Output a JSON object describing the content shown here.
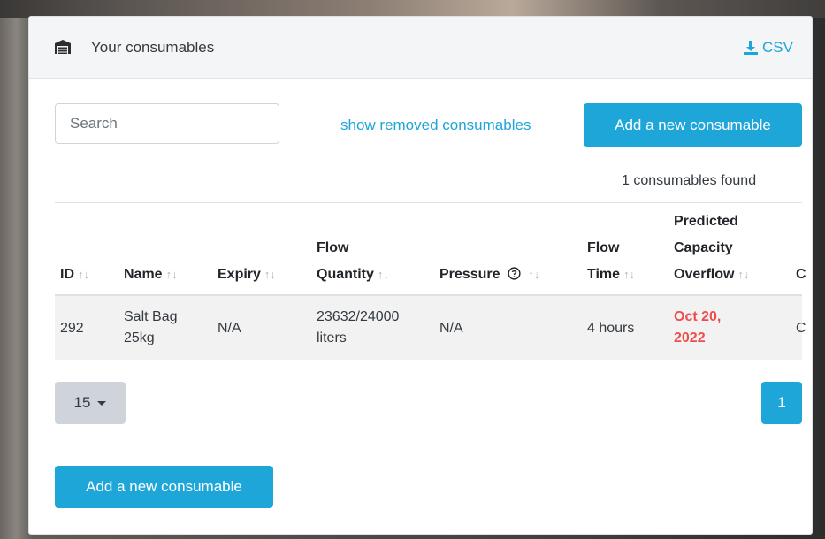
{
  "header": {
    "title": "Your consumables",
    "icon": "warehouse-icon",
    "csv_label": "CSV",
    "csv_icon": "download-icon"
  },
  "toolbar": {
    "search_placeholder": "Search",
    "show_removed_label": "show removed consumables",
    "add_label": "Add a new consumable"
  },
  "results": {
    "count_text": "1 consumables found"
  },
  "table": {
    "sort_glyph": "↑↓",
    "columns": {
      "id": "ID",
      "name": "Name",
      "expiry": "Expiry",
      "flow_quantity_1": "Flow",
      "flow_quantity_2": "Quantity",
      "pressure": "Pressure",
      "flow_time_1": "Flow",
      "flow_time_2": "Time",
      "predicted_1": "Predicted",
      "predicted_2": "Capacity",
      "predicted_3": "Overflow",
      "next_partial": "C"
    },
    "rows": [
      {
        "id": "292",
        "name_1": "Salt Bag",
        "name_2": "25kg",
        "expiry": "N/A",
        "flow_quantity_1": "23632/24000",
        "flow_quantity_2": "liters",
        "pressure": "N/A",
        "flow_time": "4 hours",
        "overflow_1": "Oct 20,",
        "overflow_2": "2022",
        "next_partial": "C"
      }
    ]
  },
  "pagination": {
    "per_page": "15",
    "current_page": "1"
  },
  "footer": {
    "add_label": "Add a new consumable"
  },
  "colors": {
    "accent": "#1ea6d8",
    "danger": "#ef4d4d",
    "header_bg": "#f4f5f7"
  }
}
